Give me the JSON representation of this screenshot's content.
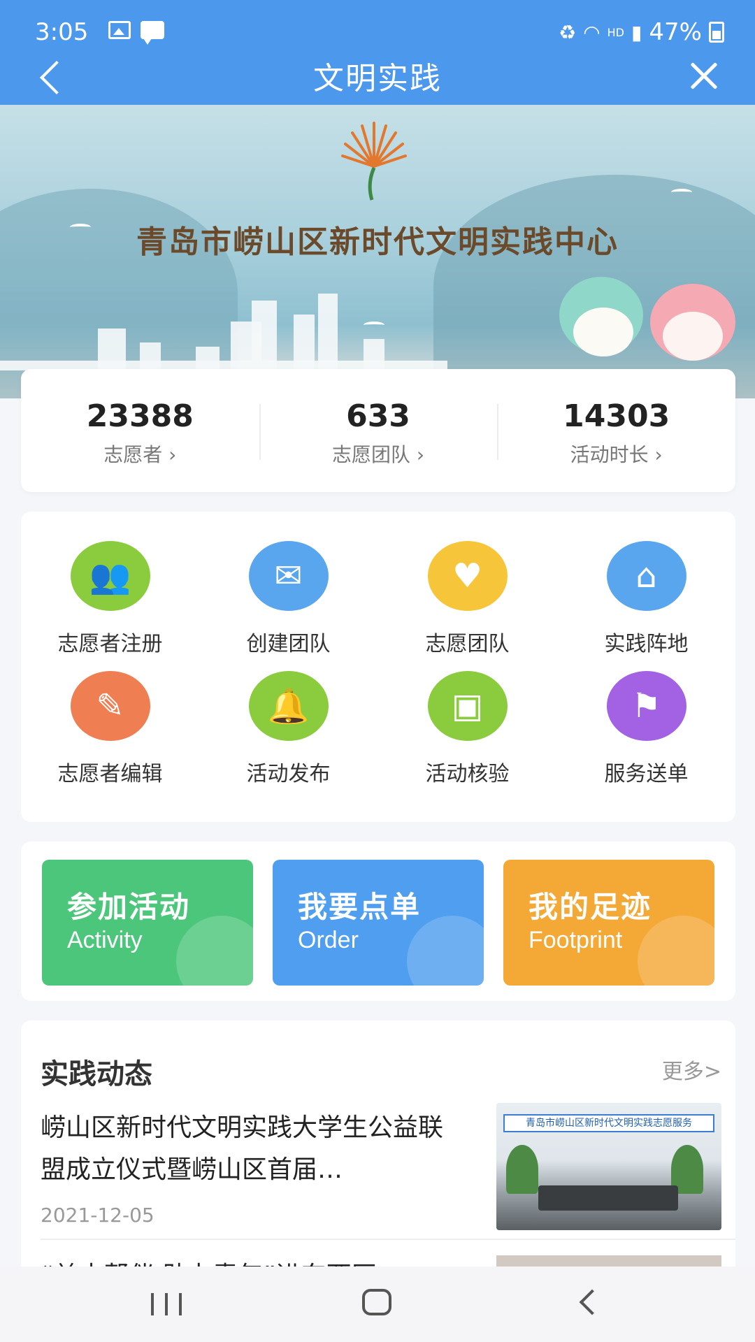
{
  "status_bar": {
    "time": "3:05",
    "hd": "HD",
    "battery": "47%"
  },
  "header": {
    "title": "文明实践"
  },
  "banner": {
    "title": "青岛市崂山区新时代文明实践中心"
  },
  "stats": [
    {
      "value": "23388",
      "label": "志愿者 ›"
    },
    {
      "value": "633",
      "label": "志愿团队 ›"
    },
    {
      "value": "14303",
      "label": "活动时长 ›"
    }
  ],
  "features": [
    {
      "label": "志愿者注册",
      "icon": "user-group-icon",
      "color": "#8bcc3e",
      "glyph": "👥"
    },
    {
      "label": "创建团队",
      "icon": "envelope-heart-icon",
      "color": "#5aa6ee",
      "glyph": "✉"
    },
    {
      "label": "志愿团队",
      "icon": "chat-heart-icon",
      "color": "#f7c53a",
      "glyph": "♥"
    },
    {
      "label": "实践阵地",
      "icon": "home-icon",
      "color": "#5aa6ee",
      "glyph": "⌂"
    },
    {
      "label": "志愿者编辑",
      "icon": "footprint-icon",
      "color": "#ef7e52",
      "glyph": "✎"
    },
    {
      "label": "活动发布",
      "icon": "bell-icon",
      "color": "#8bcc3e",
      "glyph": "🔔"
    },
    {
      "label": "活动核验",
      "icon": "scan-icon",
      "color": "#8bcc3e",
      "glyph": "▣"
    },
    {
      "label": "服务送单",
      "icon": "flag-icon",
      "color": "#a262e3",
      "glyph": "⚑"
    }
  ],
  "actions": [
    {
      "title": "参加活动",
      "subtitle": "Activity",
      "color": "#4cc67b"
    },
    {
      "title": "我要点单",
      "subtitle": "Order",
      "color": "#4f9ef0"
    },
    {
      "title": "我的足迹",
      "subtitle": "Footprint",
      "color": "#f4a836"
    }
  ],
  "news": {
    "heading": "实践动态",
    "more": "更多>",
    "items": [
      {
        "title": "崂山区新时代文明实践大学生公益联盟成立仪式暨崂山区首届…",
        "date": "2021-12-05",
        "image_caption": "青岛市崂山区新时代文明实践志愿服务"
      },
      {
        "title": "“益志帮伴 助力青年”进东西区"
      }
    ]
  }
}
